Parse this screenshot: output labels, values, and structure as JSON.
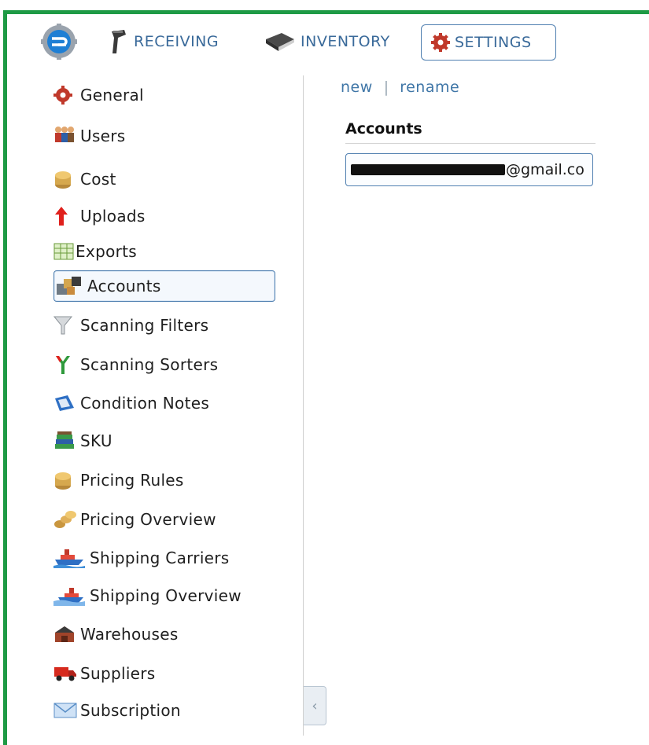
{
  "nav": {
    "tabs": [
      {
        "label": "RECEIVING",
        "icon": "scanner-icon"
      },
      {
        "label": "INVENTORY",
        "icon": "book-icon"
      },
      {
        "label": "SETTINGS",
        "icon": "gear-icon",
        "active": true
      }
    ]
  },
  "sidebar": {
    "items": [
      {
        "label": "General",
        "icon": "gear-icon"
      },
      {
        "label": "Users",
        "icon": "users-icon"
      },
      {
        "label": "Cost",
        "icon": "coins-icon"
      },
      {
        "label": "Uploads",
        "icon": "upload-arrow-icon"
      },
      {
        "label": "Exports",
        "icon": "spreadsheet-icon"
      },
      {
        "label": "Accounts",
        "icon": "accounts-icon",
        "active": true
      },
      {
        "label": "Scanning Filters",
        "icon": "funnel-icon"
      },
      {
        "label": "Scanning Sorters",
        "icon": "fork-icon"
      },
      {
        "label": "Condition Notes",
        "icon": "note-icon"
      },
      {
        "label": "SKU",
        "icon": "books-icon"
      },
      {
        "label": "Pricing Rules",
        "icon": "coins-icon"
      },
      {
        "label": "Pricing Overview",
        "icon": "coin-stack-icon"
      },
      {
        "label": "Shipping Carriers",
        "icon": "ship-icon"
      },
      {
        "label": "Shipping Overview",
        "icon": "ship-icon"
      },
      {
        "label": "Warehouses",
        "icon": "warehouse-icon"
      },
      {
        "label": "Suppliers",
        "icon": "truck-icon"
      },
      {
        "label": "Subscription",
        "icon": "envelope-icon"
      }
    ]
  },
  "main": {
    "actions": {
      "new_label": "new",
      "separator": "|",
      "rename_label": "rename"
    },
    "accounts_header": "Accounts",
    "accounts": [
      {
        "email_suffix": "@gmail.co",
        "redacted": true
      }
    ]
  },
  "colors": {
    "frame": "#1e9a45",
    "link": "#3f76a7",
    "active_border": "#4f7fb0"
  }
}
